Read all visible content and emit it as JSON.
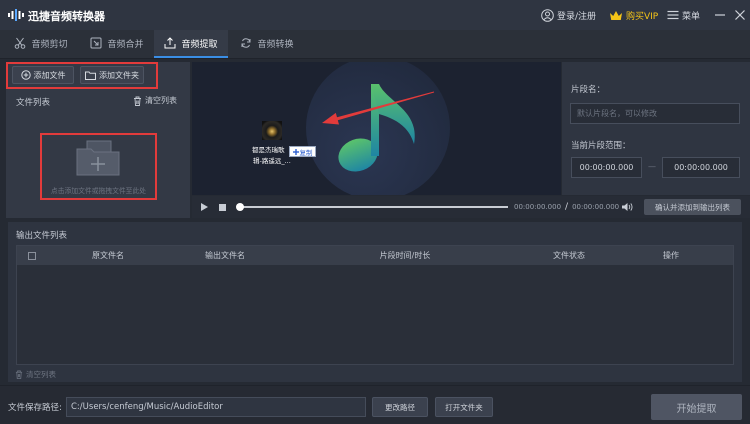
{
  "app": {
    "title": "迅捷音频转换器"
  },
  "header": {
    "login_label": "登录/注册",
    "vip_label": "购买VIP",
    "menu_label": "菜单"
  },
  "tabs": [
    {
      "label": "音频剪切",
      "icon": "scissors-icon"
    },
    {
      "label": "音频合并",
      "icon": "merge-icon"
    },
    {
      "label": "音频提取",
      "icon": "extract-icon",
      "active": true
    },
    {
      "label": "音频转换",
      "icon": "convert-icon"
    }
  ],
  "file_panel": {
    "add_file_label": "添加文件",
    "add_folder_label": "添加文件夹",
    "list_title": "文件列表",
    "clear_label": "清空列表",
    "drop_hint": "点击添加文件或拖拽文件至此处"
  },
  "drag_item": {
    "name_line1": "都是杰瑞歌",
    "name_line2": "辑-路遥远_...",
    "copy_label": "复制"
  },
  "clip_panel": {
    "name_label": "片段名：",
    "name_placeholder": "默认片段名，可以修改",
    "range_label": "当前片段范围：",
    "start_time": "00:00:00.000",
    "range_separator": "—",
    "end_time": "00:00:00.000"
  },
  "player": {
    "current_time": "00:00:00.000",
    "time_separator": "/",
    "total_time": "00:00:00.000",
    "progress": 0,
    "confirm_label": "确认并添加到输出列表"
  },
  "output": {
    "title": "输出文件列表",
    "columns": [
      "原文件名",
      "输出文件名",
      "片段时间/时长",
      "文件状态",
      "操作"
    ],
    "clear_label": "清空列表"
  },
  "footer": {
    "path_label": "文件保存路径:",
    "path_value": "C:/Users/cenfeng/Music/AudioEditor",
    "change_path_label": "更改路径",
    "open_folder_label": "打开文件夹",
    "start_label": "开始提取"
  },
  "colors": {
    "accent": "#3a8ee6",
    "vip": "#f5c518",
    "annotation": "#e23b3b",
    "note_top": "#5ac26c",
    "note_bottom": "#1f86a3"
  }
}
